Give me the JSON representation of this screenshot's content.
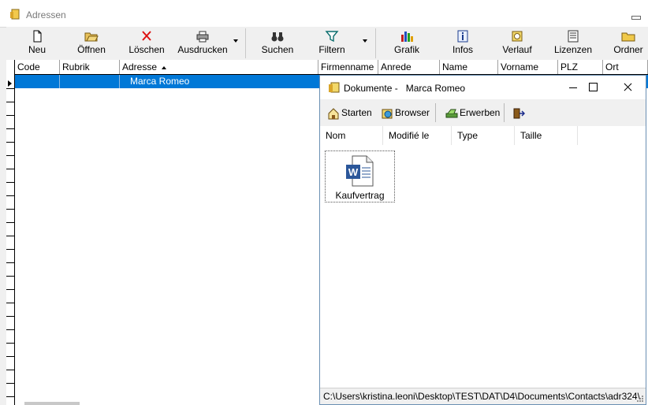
{
  "window": {
    "title": "Adressen",
    "app_icon": "address-book-icon"
  },
  "toolbar": {
    "buttons": [
      {
        "label": "Neu",
        "icon": "new-document-icon"
      },
      {
        "label": "Öffnen",
        "icon": "open-folder-icon"
      },
      {
        "label": "Löschen",
        "icon": "delete-x-icon"
      },
      {
        "label": "Ausdrucken",
        "icon": "printer-icon"
      },
      {
        "label": "Suchen",
        "icon": "binoculars-icon"
      },
      {
        "label": "Filtern",
        "icon": "filter-funnel-icon"
      },
      {
        "label": "Grafik",
        "icon": "bar-chart-icon"
      },
      {
        "label": "Infos",
        "icon": "info-icon"
      },
      {
        "label": "Verlauf",
        "icon": "history-icon"
      },
      {
        "label": "Lizenzen",
        "icon": "license-icon"
      },
      {
        "label": "Ordner",
        "icon": "folder-icon"
      }
    ]
  },
  "grid": {
    "columns": [
      "Code",
      "Rubrik",
      "Adresse",
      "Firmenname",
      "Anrede",
      "Name",
      "Vorname",
      "PLZ",
      "Ort"
    ],
    "sorted_column": "Adresse",
    "rows": [
      {
        "code": "",
        "rubrik": "",
        "adresse": "Marca Romeo"
      }
    ],
    "selection_color": "#0078d7"
  },
  "documents_window": {
    "title": "Dokumente -",
    "contact": "Marca Romeo",
    "toolbar": {
      "starten": "Starten",
      "browser": "Browser",
      "erwerben": "Erwerben"
    },
    "columns": [
      "Nom",
      "Modifié le",
      "Type",
      "Taille"
    ],
    "files": [
      {
        "name": "Kaufvertrag",
        "icon": "word-document-icon"
      }
    ],
    "status_path": "C:\\Users\\kristina.leoni\\Desktop\\TEST\\DAT\\D4\\Documents\\Contacts\\adr324\\"
  }
}
